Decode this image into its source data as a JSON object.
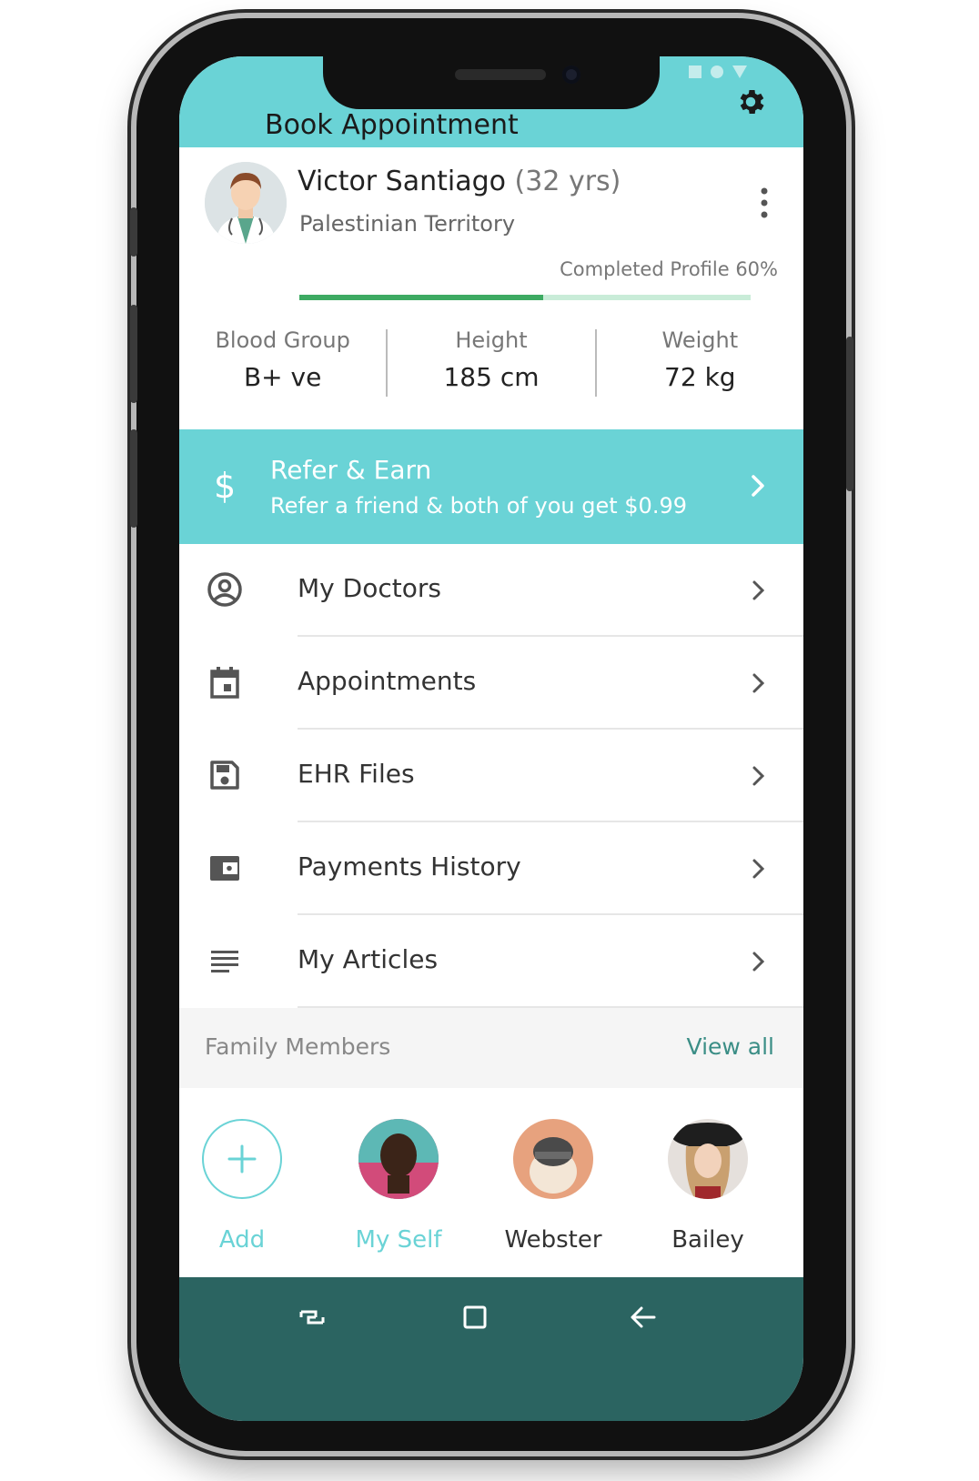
{
  "header": {
    "title": "Book Appointment",
    "status_icons": [
      "square-icon",
      "circle-icon",
      "triangle-icon"
    ],
    "settings_icon": "gear-icon"
  },
  "profile": {
    "name": "Victor Santiago",
    "age": "(32 yrs)",
    "location": "Palestinian Territory",
    "completion_label": "Completed Profile 60%",
    "completion_fraction": 0.54,
    "stats": [
      {
        "label": "Blood Group",
        "value": "B+ ve"
      },
      {
        "label": "Height",
        "value": "185 cm"
      },
      {
        "label": "Weight",
        "value": "72 kg"
      }
    ]
  },
  "refer": {
    "icon": "$",
    "title": "Refer & Earn",
    "subtitle": "Refer a friend & both of you get $0.99"
  },
  "menu": [
    {
      "label": "My Doctors",
      "icon": "account-circle-icon"
    },
    {
      "label": "Appointments",
      "icon": "calendar-icon"
    },
    {
      "label": "EHR Files",
      "icon": "save-file-icon"
    },
    {
      "label": "Payments History",
      "icon": "wallet-icon"
    },
    {
      "label": "My Articles",
      "icon": "list-lines-icon"
    }
  ],
  "family": {
    "title": "Family Members",
    "view_all": "View all",
    "members": [
      {
        "name": "Add"
      },
      {
        "name": "My Self"
      },
      {
        "name": "Webster"
      },
      {
        "name": "Bailey"
      }
    ]
  },
  "navbar": {
    "buttons": [
      "recent-apps-icon",
      "home-icon",
      "back-icon"
    ]
  },
  "colors": {
    "accent": "#6ad3d6",
    "navbar": "#2b6461",
    "progress": "#3daa62",
    "link": "#3b8e86"
  }
}
